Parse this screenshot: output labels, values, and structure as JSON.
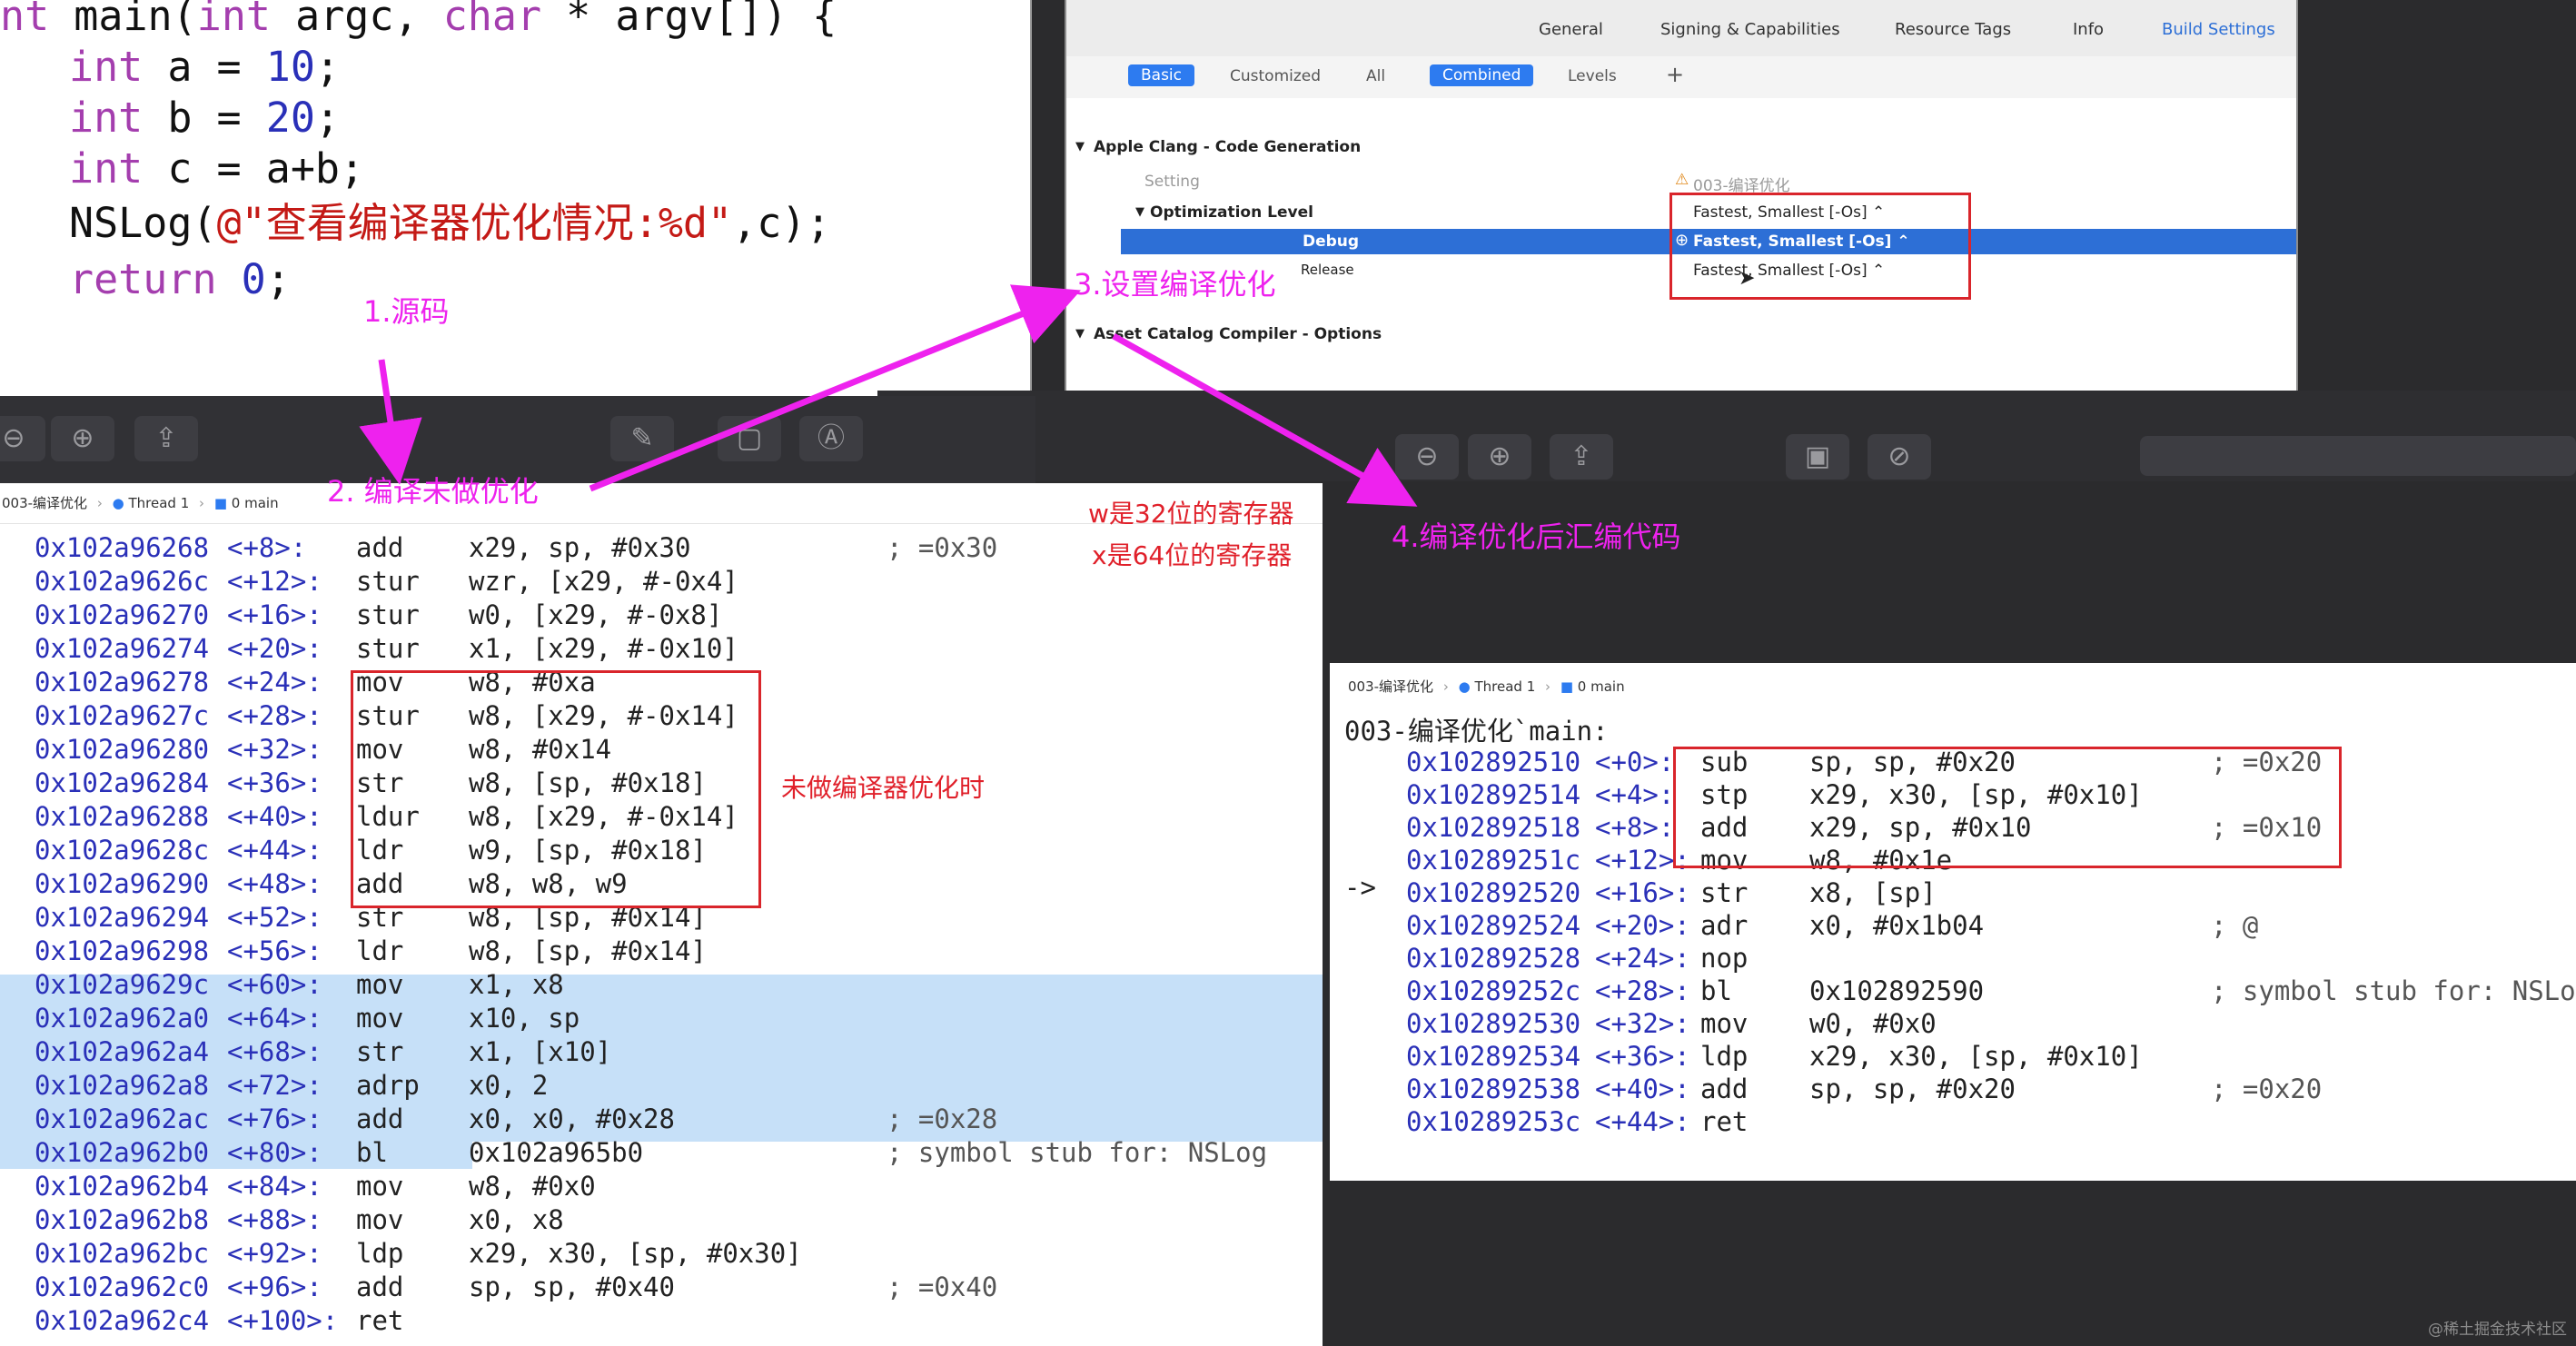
{
  "source": {
    "lines": [
      "nt main(int argc, char * argv[]) {",
      "    int a = 10;",
      "    int b = 20;",
      "    int c = a+b;",
      "    NSLog(@\"查看编译器优化情况:%d\",c);",
      "    return 0;"
    ],
    "segments": {
      "l0a": "nt ",
      "l0b": "main(",
      "l0c": "int",
      "l0d": " argc, ",
      "l0e": "char",
      "l0f": " * argv[]) {",
      "l1a": "int",
      "l1b": " a = ",
      "l1c": "10",
      "l1d": ";",
      "l2a": "int",
      "l2b": " b = ",
      "l2c": "20",
      "l2d": ";",
      "l3a": "int",
      "l3b": " c = a+b;",
      "l4a": "NSLog(",
      "l4b": "@\"查看编译器优化情况:%d\"",
      "l4c": ",c);",
      "l5a": "return",
      "l5b": " ",
      "l5c": "0",
      "l5d": ";"
    }
  },
  "xcode": {
    "tabs": [
      "General",
      "Signing & Capabilities",
      "Resource Tags",
      "Info",
      "Build Settings"
    ],
    "active_tab": "Build Settings",
    "filters": [
      "Basic",
      "Customized",
      "All",
      "Combined",
      "Levels",
      "+"
    ],
    "section_1": "Apple Clang - Code Generation",
    "setting_header": "Setting",
    "target_header": "003-编译优化",
    "optimization_level": "Optimization Level",
    "debug_label": "Debug",
    "release_label": "Release",
    "value_top": "Fastest, Smallest [-Os] ⌃",
    "value_debug": "Fastest, Smallest [-Os] ⌃",
    "value_release": "Fastest, Smallest [-Os] ⌃",
    "section_2": "Asset Catalog Compiler - Options"
  },
  "annotations": {
    "step1": "1.源码",
    "step2": "2. 编译未做优化",
    "step3": "3.设置编译优化",
    "step4": "4.编译优化后汇编代码",
    "w_note": "w是32位的寄存器",
    "x_note": "x是64位的寄存器",
    "unopt_note": "未做编译器优化时",
    "watermark": "@稀土掘金技术社区"
  },
  "left_disasm": {
    "breadcrumb": {
      "target": "003-编译优化",
      "thread": "Thread 1",
      "frame": "0 main"
    },
    "rows": [
      {
        "addr": "0x102a96268",
        "off": "<+8>:",
        "op": "add",
        "args": "x29, sp, #0x30",
        "comment": "; =0x30"
      },
      {
        "addr": "0x102a9626c",
        "off": "<+12>:",
        "op": "stur",
        "args": "wzr, [x29, #-0x4]",
        "comment": ""
      },
      {
        "addr": "0x102a96270",
        "off": "<+16>:",
        "op": "stur",
        "args": "w0, [x29, #-0x8]",
        "comment": ""
      },
      {
        "addr": "0x102a96274",
        "off": "<+20>:",
        "op": "stur",
        "args": "x1, [x29, #-0x10]",
        "comment": ""
      },
      {
        "addr": "0x102a96278",
        "off": "<+24>:",
        "op": "mov",
        "args": "w8, #0xa",
        "comment": ""
      },
      {
        "addr": "0x102a9627c",
        "off": "<+28>:",
        "op": "stur",
        "args": "w8, [x29, #-0x14]",
        "comment": ""
      },
      {
        "addr": "0x102a96280",
        "off": "<+32>:",
        "op": "mov",
        "args": "w8, #0x14",
        "comment": ""
      },
      {
        "addr": "0x102a96284",
        "off": "<+36>:",
        "op": "str",
        "args": "w8, [sp, #0x18]",
        "comment": ""
      },
      {
        "addr": "0x102a96288",
        "off": "<+40>:",
        "op": "ldur",
        "args": "w8, [x29, #-0x14]",
        "comment": ""
      },
      {
        "addr": "0x102a9628c",
        "off": "<+44>:",
        "op": "ldr",
        "args": "w9, [sp, #0x18]",
        "comment": ""
      },
      {
        "addr": "0x102a96290",
        "off": "<+48>:",
        "op": "add",
        "args": "w8, w8, w9",
        "comment": ""
      },
      {
        "addr": "0x102a96294",
        "off": "<+52>:",
        "op": "str",
        "args": "w8, [sp, #0x14]",
        "comment": ""
      },
      {
        "addr": "0x102a96298",
        "off": "<+56>:",
        "op": "ldr",
        "args": "w8, [sp, #0x14]",
        "comment": ""
      },
      {
        "addr": "0x102a9629c",
        "off": "<+60>:",
        "op": "mov",
        "args": "x1, x8",
        "comment": ""
      },
      {
        "addr": "0x102a962a0",
        "off": "<+64>:",
        "op": "mov",
        "args": "x10, sp",
        "comment": ""
      },
      {
        "addr": "0x102a962a4",
        "off": "<+68>:",
        "op": "str",
        "args": "x1, [x10]",
        "comment": ""
      },
      {
        "addr": "0x102a962a8",
        "off": "<+72>:",
        "op": "adrp",
        "args": "x0, 2",
        "comment": ""
      },
      {
        "addr": "0x102a962ac",
        "off": "<+76>:",
        "op": "add",
        "args": "x0, x0, #0x28",
        "comment": "; =0x28"
      },
      {
        "addr": "0x102a962b0",
        "off": "<+80>:",
        "op": "bl",
        "args": "0x102a965b0",
        "comment": "; symbol stub for: NSLog"
      },
      {
        "addr": "0x102a962b4",
        "off": "<+84>:",
        "op": "mov",
        "args": "w8, #0x0",
        "comment": ""
      },
      {
        "addr": "0x102a962b8",
        "off": "<+88>:",
        "op": "mov",
        "args": "x0, x8",
        "comment": ""
      },
      {
        "addr": "0x102a962bc",
        "off": "<+92>:",
        "op": "ldp",
        "args": "x29, x30, [sp, #0x30]",
        "comment": ""
      },
      {
        "addr": "0x102a962c0",
        "off": "<+96>:",
        "op": "add",
        "args": "sp, sp, #0x40",
        "comment": "; =0x40"
      },
      {
        "addr": "0x102a962c4",
        "off": "<+100>:",
        "op": "ret",
        "args": "",
        "comment": ""
      }
    ]
  },
  "right_disasm": {
    "breadcrumb": {
      "target": "003-编译优化",
      "thread": "Thread 1",
      "frame": "0 main"
    },
    "title": "003-编译优化`main:",
    "pc_marker": "->",
    "rows": [
      {
        "addr": "0x102892510",
        "off": "<+0>:",
        "op": "sub",
        "args": "sp, sp, #0x20",
        "comment": "; =0x20"
      },
      {
        "addr": "0x102892514",
        "off": "<+4>:",
        "op": "stp",
        "args": "x29, x30, [sp, #0x10]",
        "comment": ""
      },
      {
        "addr": "0x102892518",
        "off": "<+8>:",
        "op": "add",
        "args": "x29, sp, #0x10",
        "comment": "; =0x10"
      },
      {
        "addr": "0x10289251c",
        "off": "<+12>:",
        "op": "mov",
        "args": "w8, #0x1e",
        "comment": ""
      },
      {
        "addr": "0x102892520",
        "off": "<+16>:",
        "op": "str",
        "args": "x8, [sp]",
        "comment": ""
      },
      {
        "addr": "0x102892524",
        "off": "<+20>:",
        "op": "adr",
        "args": "x0, #0x1b04",
        "comment": "; @"
      },
      {
        "addr": "0x102892528",
        "off": "<+24>:",
        "op": "nop",
        "args": "",
        "comment": ""
      },
      {
        "addr": "0x10289252c",
        "off": "<+28>:",
        "op": "bl",
        "args": "0x102892590",
        "comment": "; symbol stub for: NSLog"
      },
      {
        "addr": "0x102892530",
        "off": "<+32>:",
        "op": "mov",
        "args": "w0, #0x0",
        "comment": ""
      },
      {
        "addr": "0x102892534",
        "off": "<+36>:",
        "op": "ldp",
        "args": "x29, x30, [sp, #0x10]",
        "comment": ""
      },
      {
        "addr": "0x102892538",
        "off": "<+40>:",
        "op": "add",
        "args": "sp, sp, #0x20",
        "comment": "; =0x20"
      },
      {
        "addr": "0x10289253c",
        "off": "<+44>:",
        "op": "ret",
        "args": "",
        "comment": ""
      }
    ]
  },
  "colors": {
    "annotation": "#ee22ee",
    "red_box": "#d9252b",
    "keyword": "#a43eae",
    "number": "#2a30b8",
    "string": "#c41a16",
    "selection": "#2d6fd6",
    "highlight": "#c6e0f8"
  }
}
